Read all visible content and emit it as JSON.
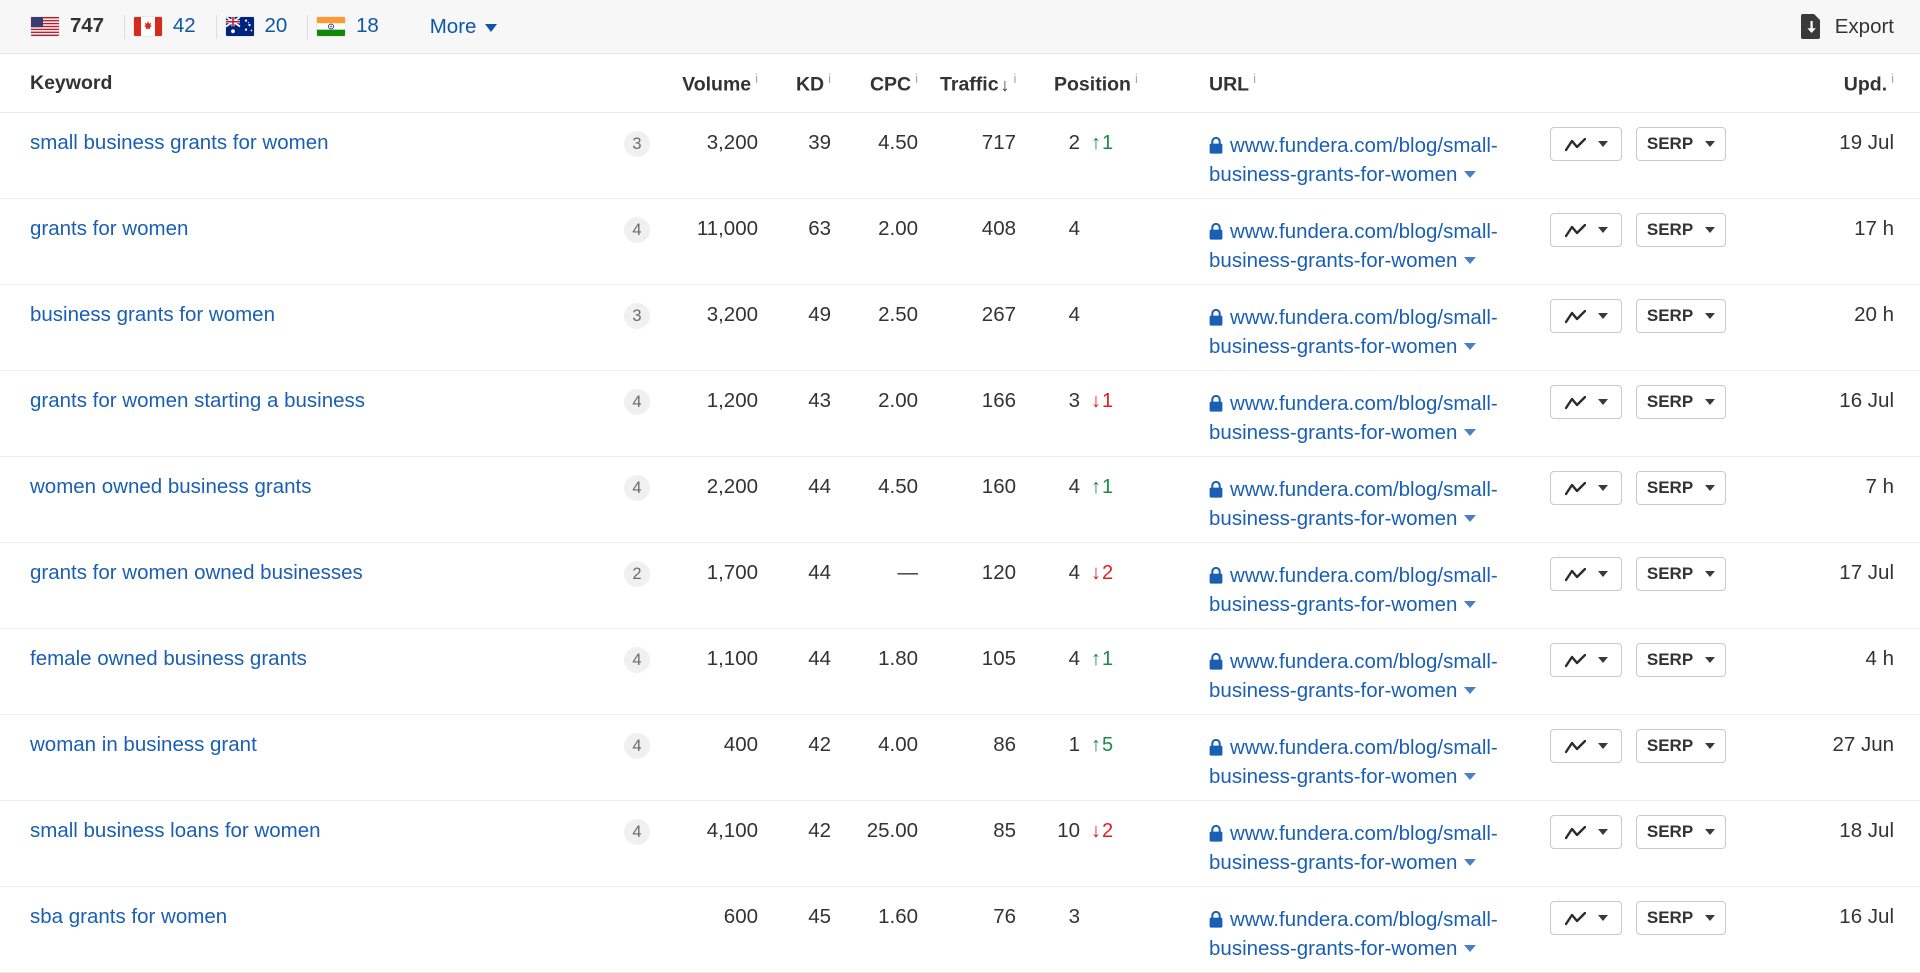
{
  "topbar": {
    "countries": [
      {
        "name": "United States",
        "icon": "flag-us-icon",
        "count": "747",
        "active": true
      },
      {
        "name": "Canada",
        "icon": "flag-ca-icon",
        "count": "42",
        "active": false
      },
      {
        "name": "Australia",
        "icon": "flag-au-icon",
        "count": "20",
        "active": false
      },
      {
        "name": "India",
        "icon": "flag-in-icon",
        "count": "18",
        "active": false
      }
    ],
    "more_label": "More",
    "export_label": "Export",
    "export_icon": "export-download-icon",
    "caret_icon": "chevron-down-icon"
  },
  "table": {
    "columns": [
      {
        "key": "keyword",
        "label": "Keyword",
        "info": false,
        "sorted": false
      },
      {
        "key": "volume",
        "label": "Volume",
        "info": true,
        "sorted": false
      },
      {
        "key": "kd",
        "label": "KD",
        "info": true,
        "sorted": false
      },
      {
        "key": "cpc",
        "label": "CPC",
        "info": true,
        "sorted": false
      },
      {
        "key": "traffic",
        "label": "Traffic",
        "info": true,
        "sorted": true,
        "sort_dir": "↓"
      },
      {
        "key": "position",
        "label": "Position",
        "info": true,
        "sorted": false
      },
      {
        "key": "url",
        "label": "URL",
        "info": true,
        "sorted": false
      },
      {
        "key": "upd",
        "label": "Upd.",
        "info": true,
        "sorted": false
      }
    ],
    "info_glyph": "i",
    "buttons": {
      "chart_label": "",
      "chart_icon": "line-chart-icon",
      "serp_label": "SERP",
      "caret_icon": "chevron-down-icon"
    },
    "url_lock_icon": "lock-icon",
    "rows": [
      {
        "keyword": "small business grants for women",
        "badge": "3",
        "volume": "3,200",
        "kd": "39",
        "cpc": "4.50",
        "traffic": "717",
        "position": "2",
        "delta": "1",
        "delta_dir": "up",
        "url_line1": "www.fundera.com/blog/small-",
        "url_line2": "business-grants-for-women",
        "upd": "19 Jul"
      },
      {
        "keyword": "grants for women",
        "badge": "4",
        "volume": "11,000",
        "kd": "63",
        "cpc": "2.00",
        "traffic": "408",
        "position": "4",
        "delta": "",
        "delta_dir": "none",
        "url_line1": "www.fundera.com/blog/small-",
        "url_line2": "business-grants-for-women",
        "upd": "17 h"
      },
      {
        "keyword": "business grants for women",
        "badge": "3",
        "volume": "3,200",
        "kd": "49",
        "cpc": "2.50",
        "traffic": "267",
        "position": "4",
        "delta": "",
        "delta_dir": "none",
        "url_line1": "www.fundera.com/blog/small-",
        "url_line2": "business-grants-for-women",
        "upd": "20 h"
      },
      {
        "keyword": "grants for women starting a business",
        "badge": "4",
        "volume": "1,200",
        "kd": "43",
        "cpc": "2.00",
        "traffic": "166",
        "position": "3",
        "delta": "1",
        "delta_dir": "down",
        "url_line1": "www.fundera.com/blog/small-",
        "url_line2": "business-grants-for-women",
        "upd": "16 Jul"
      },
      {
        "keyword": "women owned business grants",
        "badge": "4",
        "volume": "2,200",
        "kd": "44",
        "cpc": "4.50",
        "traffic": "160",
        "position": "4",
        "delta": "1",
        "delta_dir": "up",
        "url_line1": "www.fundera.com/blog/small-",
        "url_line2": "business-grants-for-women",
        "upd": "7 h"
      },
      {
        "keyword": "grants for women owned businesses",
        "badge": "2",
        "volume": "1,700",
        "kd": "44",
        "cpc": "—",
        "traffic": "120",
        "position": "4",
        "delta": "2",
        "delta_dir": "down",
        "url_line1": "www.fundera.com/blog/small-",
        "url_line2": "business-grants-for-women",
        "upd": "17 Jul"
      },
      {
        "keyword": "female owned business grants",
        "badge": "4",
        "volume": "1,100",
        "kd": "44",
        "cpc": "1.80",
        "traffic": "105",
        "position": "4",
        "delta": "1",
        "delta_dir": "up",
        "url_line1": "www.fundera.com/blog/small-",
        "url_line2": "business-grants-for-women",
        "upd": "4 h"
      },
      {
        "keyword": "woman in business grant",
        "badge": "4",
        "volume": "400",
        "kd": "42",
        "cpc": "4.00",
        "traffic": "86",
        "position": "1",
        "delta": "5",
        "delta_dir": "up",
        "url_line1": "www.fundera.com/blog/small-",
        "url_line2": "business-grants-for-women",
        "upd": "27 Jun"
      },
      {
        "keyword": "small business loans for women",
        "badge": "4",
        "volume": "4,100",
        "kd": "42",
        "cpc": "25.00",
        "traffic": "85",
        "position": "10",
        "delta": "2",
        "delta_dir": "down",
        "url_line1": "www.fundera.com/blog/small-",
        "url_line2": "business-grants-for-women",
        "upd": "18 Jul"
      },
      {
        "keyword": "sba grants for women",
        "badge": "",
        "volume": "600",
        "kd": "45",
        "cpc": "1.60",
        "traffic": "76",
        "position": "3",
        "delta": "",
        "delta_dir": "none",
        "url_line1": "www.fundera.com/blog/small-",
        "url_line2": "business-grants-for-women",
        "upd": "16 Jul"
      }
    ]
  },
  "colors": {
    "link": "#1a5fb4",
    "up": "#1a8a4a",
    "down": "#e02020",
    "topbar_bg": "#f7f7f7",
    "badge_bg": "#f0f0f0"
  }
}
